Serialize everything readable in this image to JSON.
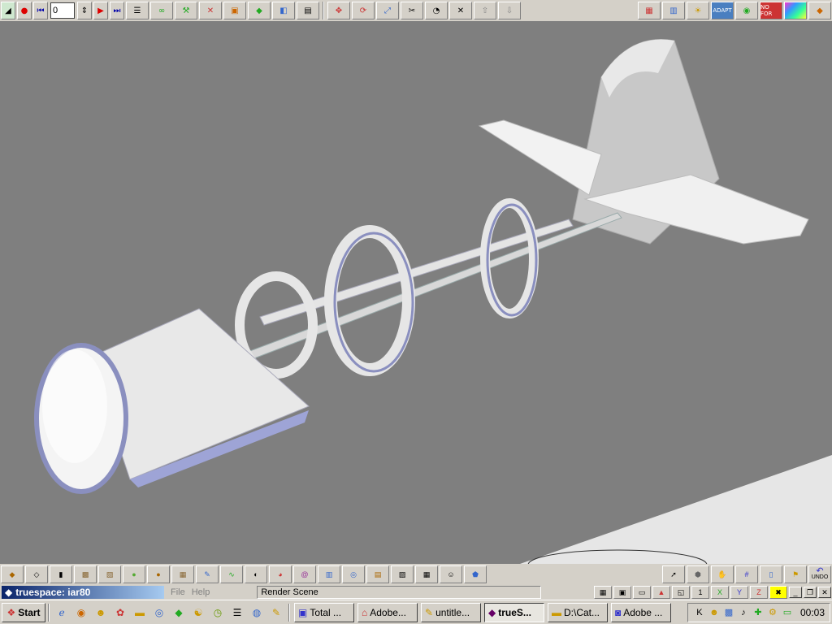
{
  "top_toolbar": {
    "frame_number": "0",
    "buttons_left": [
      "record-icon",
      "rewind-icon",
      "play-icon",
      "end-icon"
    ],
    "buttons_right": [
      "cube-icon",
      "paint-icon",
      "adapt-icon",
      "no-for-icon"
    ]
  },
  "window": {
    "title": "truespace: iar80",
    "menu": [
      "File",
      "Help"
    ],
    "status": "Render Scene"
  },
  "taskbar": {
    "start_label": "Start",
    "tasks": [
      {
        "label": "Total ...",
        "active": false
      },
      {
        "label": "Adobe...",
        "active": false
      },
      {
        "label": "untitle...",
        "active": false
      },
      {
        "label": "trueS...",
        "active": true
      },
      {
        "label": "D:\\Cat...",
        "active": false
      },
      {
        "label": "Adobe ...",
        "active": false
      }
    ],
    "clock": "00:03"
  },
  "badges": {
    "adapt": "ADAPT",
    "nofor": "NO FOR",
    "undo": "UNDO"
  },
  "colors": {
    "viewport_bg": "#7f7f7f",
    "toolbar_bg": "#d4d0c8",
    "title_gradient_start": "#0a246a",
    "title_gradient_end": "#a6caf0"
  }
}
